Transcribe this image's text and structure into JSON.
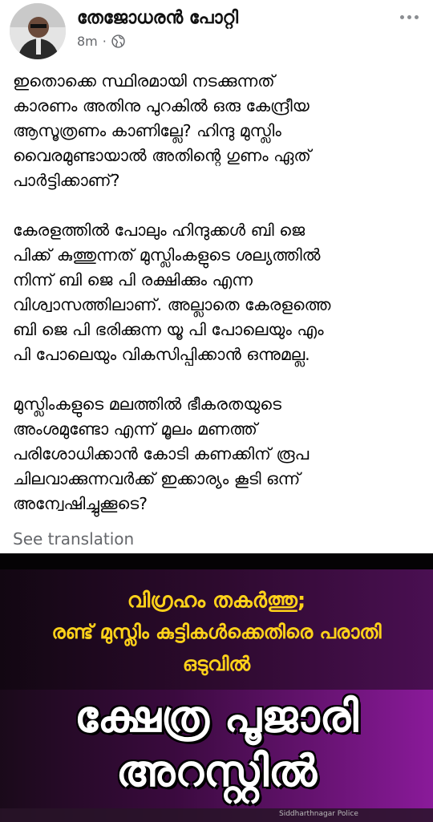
{
  "post": {
    "author": "തേജോധരൻ പോറ്റി",
    "time": "8m",
    "separator": "·",
    "paragraphs": [
      "ഇതൊക്കെ സ്ഥിരമായി നടക്കുന്നത്\nകാരണം അതിനു പുറകിൽ ഒരു കേന്ദ്രീയ\nആസൂത്രണം കാണില്ലേ?  ഹിന്ദു മുസ്ലിം\nവൈരമുണ്ടായാൽ അതിന്റെ ഗുണം ഏത്\nപാർട്ടിക്കാണ്?",
      "  കേരളത്തിൽ പോലും ഹിന്ദുക്കൾ ബി ജെ\nപിക്ക് കുത്തുന്നത് മുസ്ലിംകളുടെ ശല്യത്തിൽ\nനിന്ന് ബി ജെ പി രക്ഷിക്കും എന്ന\nവിശ്വാസത്തിലാണ്. അല്ലാതെ കേരളത്തെ\nബി ജെ പി ഭരിക്കുന്ന യൂ പി പോലെയും എം\nപി പോലെയും വികസിപ്പിക്കാൻ ഒന്നുമല്ല.",
      "മുസ്ലിംകളുടെ മലത്തിൽ ഭീകരതയുടെ\nഅംശമുണ്ടോ എന്ന് മൂലം  മണത്ത്\nപരിശോധിക്കാൻ കോടി കണക്കിന് രൂപ\nചിലവാക്കുന്നവർക്ക് ഇക്കാര്യം കൂടി ഒന്ന്\nഅന്വേഷിച്ചുക്കൂടെ?"
    ],
    "translate_label": "See translation"
  },
  "image": {
    "line1": "വിഗ്രഹം തകർത്തു;",
    "line2": "രണ്ട് മുസ്ലിം കുട്ടികൾക്കെതിരെ പരാതി",
    "line3": "ഒടുവിൽ",
    "big1": "ക്ഷേത്ര പൂജാരി",
    "big2": "അറസ്റ്റിൽ",
    "footer_text": "Siddharthnagar Police"
  },
  "icons": {
    "globe": "globe-icon",
    "more": "more-options-icon"
  },
  "colors": {
    "headline_yellow": "#ffd21a",
    "image_purple": "#8a1a9a",
    "meta_gray": "#65676b"
  }
}
